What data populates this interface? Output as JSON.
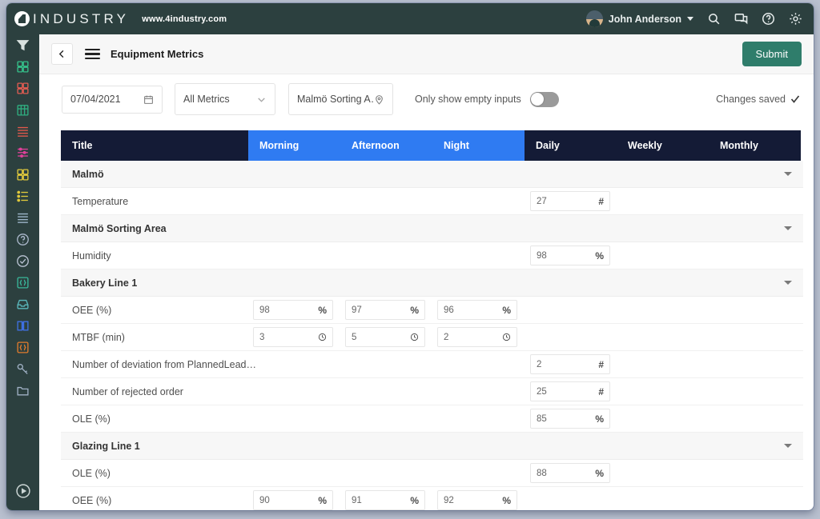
{
  "topbar": {
    "brand_name": "INDUSTRY",
    "brand_url": "www.4industry.com",
    "user_name": "John Anderson",
    "icons": [
      "search-icon",
      "chat-icon",
      "help-icon",
      "gear-icon"
    ]
  },
  "sidebar": {
    "items": [
      {
        "icon": "funnel-icon",
        "color": "#d9e2e0"
      },
      {
        "icon": "grid-squares-icon",
        "color": "#35c08a"
      },
      {
        "icon": "grid-squares-icon",
        "color": "#e05c52"
      },
      {
        "icon": "factory-icon",
        "color": "#2fae80"
      },
      {
        "icon": "list-lines-icon",
        "color": "#e4594c"
      },
      {
        "icon": "sliders-icon",
        "color": "#e0409a"
      },
      {
        "icon": "grid-squares-icon",
        "color": "#e0c93c"
      },
      {
        "icon": "checklist-icon",
        "color": "#e0c93c"
      },
      {
        "icon": "list-lines-icon",
        "color": "#9fb8cc"
      },
      {
        "icon": "help-circle-icon",
        "color": "#a9b6c9"
      },
      {
        "icon": "check-circle-icon",
        "color": "#b9c2d2"
      },
      {
        "icon": "braces-icon",
        "color": "#39b79a"
      },
      {
        "icon": "inbox-icon",
        "color": "#5ab8bc"
      },
      {
        "icon": "book-icon",
        "color": "#3f6fe0"
      },
      {
        "icon": "braces-icon",
        "color": "#e07b2d"
      },
      {
        "icon": "key-icon",
        "color": "#9fb0c4"
      },
      {
        "icon": "folder-icon",
        "color": "#9fb0c4"
      }
    ],
    "play_icon": "play-circle-icon"
  },
  "header": {
    "back_icon": "chevron-left-icon",
    "menu_icon": "hamburger-menu-icon",
    "title": "Equipment Metrics",
    "submit_label": "Submit",
    "submit_color": "#2f7d6b"
  },
  "filters": {
    "date_value": "07/04/2021",
    "date_icon": "calendar-icon",
    "metrics_value": "All Metrics",
    "metrics_icon": "chevron-down-icon",
    "location_value": "Malmö Sorting A…",
    "location_icon": "map-pin-icon",
    "toggle_label": "Only show empty inputs",
    "toggle_on": false,
    "saved_text": "Changes saved",
    "saved_icon": "check-icon"
  },
  "table": {
    "columns": [
      {
        "label": "Title",
        "kind": "title"
      },
      {
        "label": "Morning",
        "kind": "shift"
      },
      {
        "label": "Afternoon",
        "kind": "shift"
      },
      {
        "label": "Night",
        "kind": "shift"
      },
      {
        "label": "Daily",
        "kind": "period"
      },
      {
        "label": "Weekly",
        "kind": "period"
      },
      {
        "label": "Monthly",
        "kind": "period"
      }
    ],
    "shift_header_color": "#2f7bf2",
    "period_header_color": "#141b36",
    "groups": [
      {
        "name": "Malmö",
        "rows": [
          {
            "name": "Temperature",
            "cells": [
              {
                "col": "daily",
                "value": "27",
                "unit": "#"
              }
            ]
          }
        ]
      },
      {
        "name": "Malmö Sorting Area",
        "rows": [
          {
            "name": "Humidity",
            "cells": [
              {
                "col": "daily",
                "value": "98",
                "unit": "%"
              }
            ]
          }
        ]
      },
      {
        "name": "Bakery Line 1",
        "rows": [
          {
            "name": "OEE (%)",
            "cells": [
              {
                "col": "morning",
                "value": "98",
                "unit": "%"
              },
              {
                "col": "afternoon",
                "value": "97",
                "unit": "%"
              },
              {
                "col": "night",
                "value": "96",
                "unit": "%"
              }
            ]
          },
          {
            "name": "MTBF (min)",
            "cells": [
              {
                "col": "morning",
                "value": "3",
                "unit": "clock"
              },
              {
                "col": "afternoon",
                "value": "5",
                "unit": "clock"
              },
              {
                "col": "night",
                "value": "2",
                "unit": "clock"
              }
            ]
          },
          {
            "name": "Number of deviation from PlannedLead…",
            "cells": [
              {
                "col": "daily",
                "value": "2",
                "unit": "#"
              }
            ]
          },
          {
            "name": "Number of rejected order",
            "cells": [
              {
                "col": "daily",
                "value": "25",
                "unit": "#"
              }
            ]
          },
          {
            "name": "OLE (%)",
            "cells": [
              {
                "col": "daily",
                "value": "85",
                "unit": "%"
              }
            ]
          }
        ]
      },
      {
        "name": "Glazing Line 1",
        "rows": [
          {
            "name": "OLE (%)",
            "cells": [
              {
                "col": "daily",
                "value": "88",
                "unit": "%"
              }
            ]
          },
          {
            "name": "OEE (%)",
            "cells": [
              {
                "col": "morning",
                "value": "90",
                "unit": "%"
              },
              {
                "col": "afternoon",
                "value": "91",
                "unit": "%"
              },
              {
                "col": "night",
                "value": "92",
                "unit": "%"
              }
            ]
          }
        ]
      }
    ]
  }
}
